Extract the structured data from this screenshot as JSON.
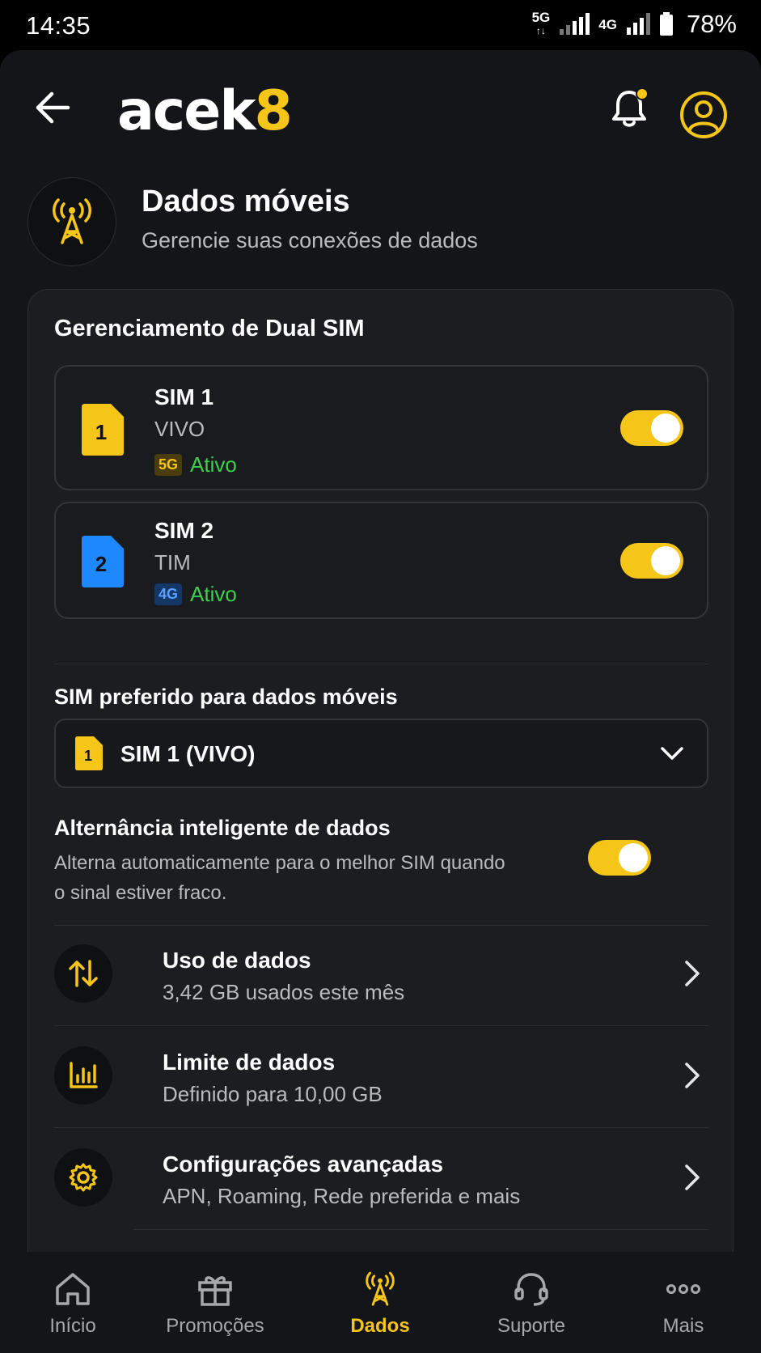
{
  "status_bar": {
    "time": "14:35",
    "network1": "5G",
    "network2": "4G",
    "battery": "78%"
  },
  "header": {
    "logo_main": "acek",
    "logo_accent": "8"
  },
  "page": {
    "title": "Dados móveis",
    "subtitle": "Gerencie suas conexões de dados"
  },
  "dual_sim": {
    "section_title": "Gerenciamento de Dual SIM",
    "sims": [
      {
        "name": "SIM 1",
        "chip_number": "1",
        "carrier": "VIVO",
        "network": "5G",
        "status": "Ativo",
        "enabled": true,
        "color": "#F5C518"
      },
      {
        "name": "SIM 2",
        "chip_number": "2",
        "carrier": "TIM",
        "network": "4G",
        "status": "Ativo",
        "enabled": true,
        "color": "#1E88FF"
      }
    ]
  },
  "preferred": {
    "label": "SIM preferido para dados móveis",
    "chip_number": "1",
    "value": "SIM 1 (VIVO)"
  },
  "smart_switch": {
    "title": "Alternância inteligente de dados",
    "description": "Alterna automaticamente para o melhor SIM quando o sinal estiver fraco.",
    "enabled": true
  },
  "menu": [
    {
      "title": "Uso de dados",
      "subtitle": "3,42 GB usados este mês",
      "icon": "data-transfer-icon"
    },
    {
      "title": "Limite de dados",
      "subtitle": "Definido para 10,00 GB",
      "icon": "bar-chart-icon"
    },
    {
      "title": "Configurações avançadas",
      "subtitle": "APN, Roaming, Rede preferida e mais",
      "icon": "gear-icon"
    }
  ],
  "nav": [
    {
      "label": "Início",
      "icon": "home-icon",
      "active": false
    },
    {
      "label": "Promoções",
      "icon": "gift-icon",
      "active": false
    },
    {
      "label": "Dados",
      "icon": "antenna-icon",
      "active": true
    },
    {
      "label": "Suporte",
      "icon": "headset-icon",
      "active": false
    },
    {
      "label": "Mais",
      "icon": "more-icon",
      "active": false
    }
  ],
  "colors": {
    "accent": "#F5C518",
    "active_green": "#3ecf4c",
    "background": "#141518",
    "card": "#1c1d21"
  }
}
